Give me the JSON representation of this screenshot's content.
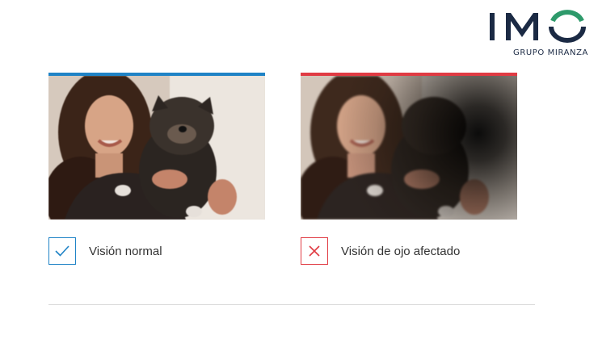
{
  "logo": {
    "letters": "IMO",
    "subtitle": "GRUPO MIRANZA",
    "colors": {
      "dark": "#1b2a44",
      "accent": "#2e9a6b"
    }
  },
  "comparison": {
    "normal": {
      "label": "Visión normal",
      "icon": "check-icon",
      "accent_color": "#1f83c6"
    },
    "affected": {
      "label": "Visión de ojo afectado",
      "icon": "close-icon",
      "accent_color": "#e03b43"
    }
  }
}
